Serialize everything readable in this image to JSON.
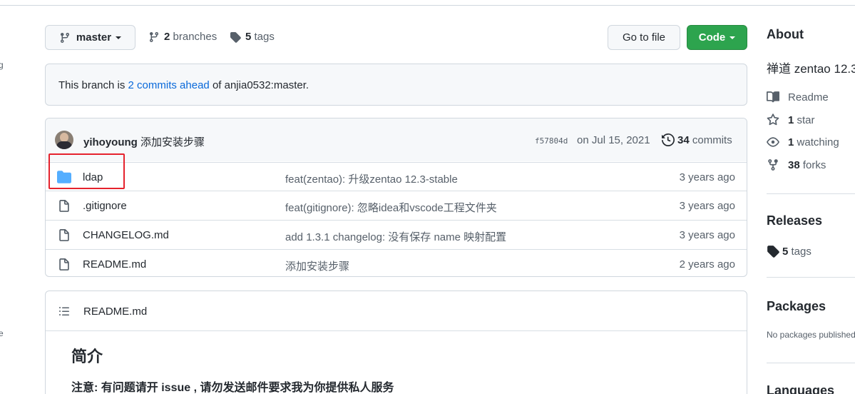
{
  "branch": {
    "name": "master"
  },
  "stats": {
    "branches_count": "2",
    "branches_label": "branches",
    "tags_count": "5",
    "tags_label": "tags"
  },
  "actions": {
    "go_to_file": "Go to file",
    "code": "Code"
  },
  "banner": {
    "prefix": "This branch is ",
    "link": "2 commits ahead",
    "suffix": " of anjia0532:master."
  },
  "commit": {
    "author": "yihoyoung",
    "message": "添加安装步骤",
    "sha": "f57804d",
    "date": "on Jul 15, 2021",
    "count": "34",
    "count_label": "commits"
  },
  "files": [
    {
      "name": "ldap",
      "type": "folder",
      "message": "feat(zentao): 升级zentao 12.3-stable",
      "age": "3 years ago"
    },
    {
      "name": ".gitignore",
      "type": "file",
      "message": "feat(gitignore): 忽略idea和vscode工程文件夹",
      "age": "3 years ago"
    },
    {
      "name": "CHANGELOG.md",
      "type": "file",
      "message": "add 1.3.1 changelog: 没有保存 name 映射配置",
      "age": "3 years ago"
    },
    {
      "name": "README.md",
      "type": "file",
      "message": "添加安装步骤",
      "age": "2 years ago"
    }
  ],
  "readme": {
    "filename": "README.md",
    "heading": "简介",
    "note": "注意: 有问题请开 issue , 请勿发送邮件要求我为你提供私人服务"
  },
  "about": {
    "title": "About",
    "description": "禅道 zentao 12.3",
    "readme": "Readme",
    "stars_count": "1",
    "stars_label": "star",
    "watching_count": "1",
    "watching_label": "watching",
    "forks_count": "38",
    "forks_label": "forks"
  },
  "releases": {
    "title": "Releases",
    "tags_count": "5",
    "tags_label": "tags"
  },
  "packages": {
    "title": "Packages",
    "empty": "No packages published"
  },
  "languages": {
    "title": "Languages"
  },
  "left_edge": {
    "a": "g",
    "b": "e"
  },
  "colors": {
    "accent_link": "#0969da",
    "code_button": "#2da44e",
    "folder": "#54aeff",
    "highlight_box": "#e5222d"
  }
}
